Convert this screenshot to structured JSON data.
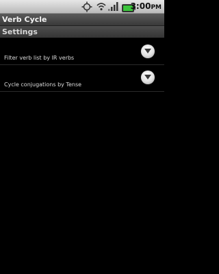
{
  "status_bar": {
    "time": "3:00",
    "time_suffix": "PM",
    "icons": [
      "gps-icon",
      "wifi-icon",
      "signal-icon",
      "battery-icon"
    ]
  },
  "app": {
    "title": "Verb Cycle"
  },
  "section": {
    "title": "Settings"
  },
  "settings": [
    {
      "label": "Filter verb list by IR verbs",
      "icon": "chevron-down-icon"
    },
    {
      "label": "Cycle conjugations by Tense",
      "icon": "chevron-down-icon"
    }
  ],
  "colors": {
    "background": "#000000",
    "status_bar": "#cfcfcf",
    "title_bar": "#4a4a4a",
    "battery": "#3cc43c"
  }
}
